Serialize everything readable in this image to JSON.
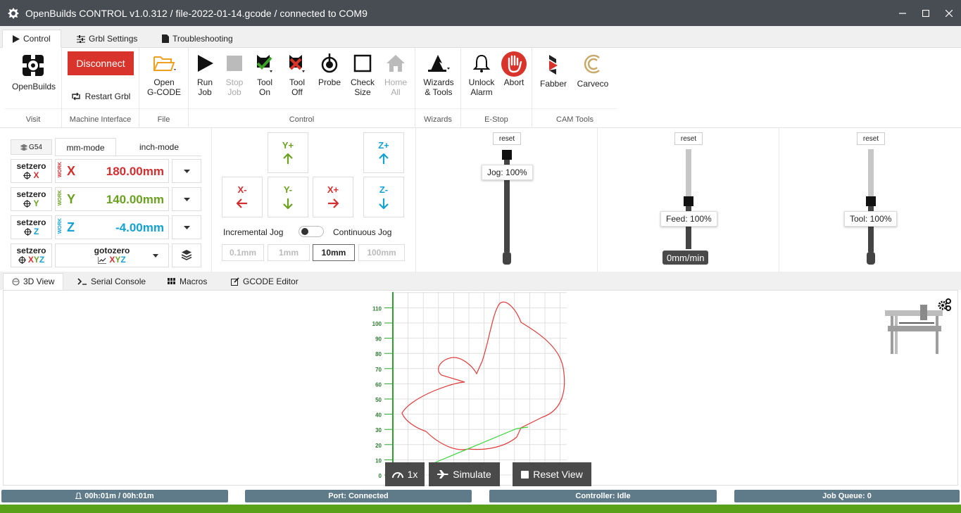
{
  "window": {
    "title": "OpenBuilds CONTROL v1.0.312 / file-2022-01-14.gcode / connected to COM9"
  },
  "ribbon_tabs": [
    {
      "label": "Control",
      "icon": "play-icon"
    },
    {
      "label": "Grbl Settings",
      "icon": "sliders-icon"
    },
    {
      "label": "Troubleshooting",
      "icon": "document-icon"
    }
  ],
  "ribbon": {
    "openbuilds": "OpenBuilds",
    "disconnect": "Disconnect",
    "restart_grbl": "Restart Grbl",
    "open_gcode_1": "Open",
    "open_gcode_2": "G-CODE",
    "run_job_1": "Run",
    "run_job_2": "Job",
    "stop_job_1": "Stop",
    "stop_job_2": "Job",
    "tool_on_1": "Tool",
    "tool_on_2": "On",
    "tool_off_1": "Tool",
    "tool_off_2": "Off",
    "probe": "Probe",
    "check_size_1": "Check",
    "check_size_2": "Size",
    "home_all_1": "Home",
    "home_all_2": "All",
    "wizards_1": "Wizards",
    "wizards_2": "& Tools",
    "unlock_1": "Unlock",
    "unlock_2": "Alarm",
    "abort": "Abort",
    "fabber": "Fabber",
    "carveco": "Carveco",
    "groups": {
      "visit": "Visit",
      "machine_interface": "Machine Interface",
      "file": "File",
      "control": "Control",
      "wizards": "Wizards",
      "estop": "E-Stop",
      "cam_tools": "CAM Tools"
    }
  },
  "dro": {
    "wcs": "G54",
    "mm_mode": "mm-mode",
    "inch_mode": "inch-mode",
    "setzero": "setzero",
    "work": "WORK",
    "axes": [
      {
        "letter": "X",
        "value": "180.00mm",
        "color": "#d32f2f"
      },
      {
        "letter": "Y",
        "value": "140.00mm",
        "color": "#6aa121"
      },
      {
        "letter": "Z",
        "value": "-4.00mm",
        "color": "#14a2d6"
      }
    ],
    "xyz": "XYZ",
    "gotozero": "gotozero"
  },
  "jog": {
    "yplus": "Y+",
    "yminus": "Y-",
    "xplus": "X+",
    "xminus": "X-",
    "zplus": "Z+",
    "zminus": "Z-",
    "incremental": "Incremental Jog",
    "continuous": "Continuous Jog",
    "steps": [
      "0.1mm",
      "1mm",
      "10mm",
      "100mm"
    ],
    "active_step": "10mm"
  },
  "overrides": {
    "reset": "reset",
    "jog_label": "Jog: 100%",
    "feed_label": "Feed: 100%",
    "tool_label": "Tool: 100%",
    "feed_rate": "0mm/min"
  },
  "lower_tabs": [
    {
      "label": "3D View",
      "icon": "cube-icon"
    },
    {
      "label": "Serial Console",
      "icon": "terminal-icon"
    },
    {
      "label": "Macros",
      "icon": "grid-icon"
    },
    {
      "label": "GCODE Editor",
      "icon": "edit-icon"
    }
  ],
  "view3d": {
    "speed": "1x",
    "simulate": "Simulate",
    "reset_view": "Reset View",
    "y_ticks": [
      "0",
      "10",
      "20",
      "30",
      "40",
      "50",
      "60",
      "70",
      "80",
      "90",
      "100",
      "110"
    ]
  },
  "status": {
    "time": "00h:01m / 00h:01m",
    "port": "Port: Connected",
    "controller": "Controller: Idle",
    "queue": "Job Queue: 0"
  }
}
